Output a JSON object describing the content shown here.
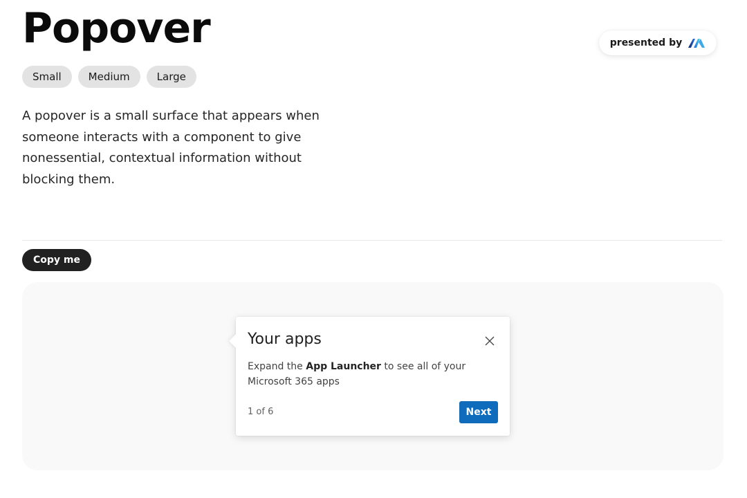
{
  "header": {
    "title": "Popover",
    "presented_by": "presented by",
    "brand_icon": "monday-logo-icon"
  },
  "size_chips": [
    {
      "label": "Small"
    },
    {
      "label": "Medium"
    },
    {
      "label": "Large"
    }
  ],
  "description": "A popover is a small surface that appears when someone interacts with a component to give nonessential, contextual information without blocking them.",
  "copy_button": {
    "label": "Copy me"
  },
  "popover": {
    "title": "Your apps",
    "close_icon": "close-icon",
    "body_prefix": "Expand the ",
    "body_bold": "App Launcher",
    "body_suffix": " to see all of your Microsoft 365 apps",
    "step": "1 of 6",
    "next_label": "Next"
  },
  "colors": {
    "primary_button": "#0f6cbd",
    "dark_button": "#212121",
    "chip_background": "#e3e3e3",
    "stage_background": "#f9f9f9"
  }
}
